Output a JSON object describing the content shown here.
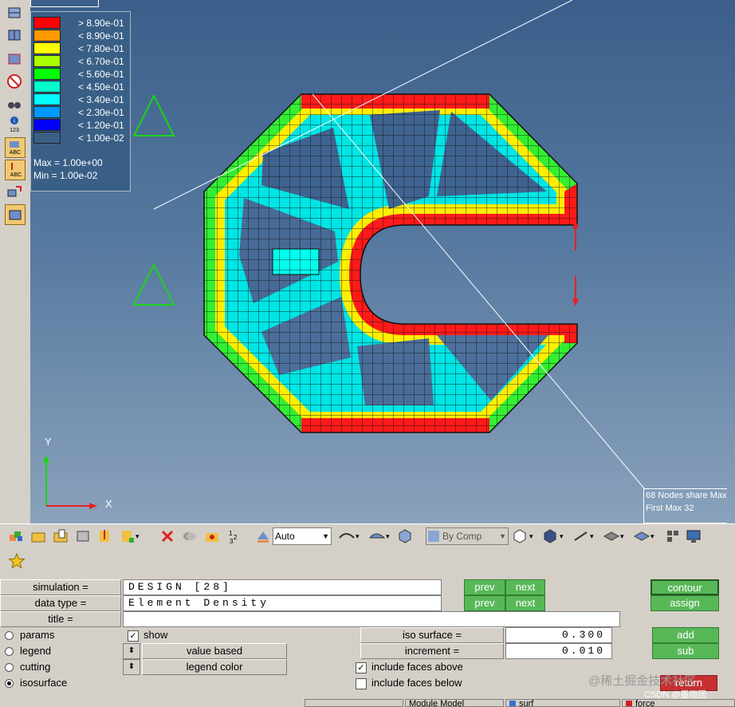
{
  "legend": {
    "entries": [
      {
        "label": "> 8.90e-01",
        "color": "#ff0000"
      },
      {
        "label": "< 8.90e-01",
        "color": "#ff9900"
      },
      {
        "label": "< 7.80e-01",
        "color": "#ffff00"
      },
      {
        "label": "< 6.70e-01",
        "color": "#aaff00"
      },
      {
        "label": "< 5.60e-01",
        "color": "#00ff00"
      },
      {
        "label": "< 4.50e-01",
        "color": "#00ffcc"
      },
      {
        "label": "< 3.40e-01",
        "color": "#00ffff"
      },
      {
        "label": "< 2.30e-01",
        "color": "#0099ff"
      },
      {
        "label": "< 1.20e-01",
        "color": "#0000ff"
      },
      {
        "label": "< 1.00e-02",
        "color": "#3a5f86"
      }
    ],
    "max_text": "Max = 1.00e+00",
    "min_text": "Min = 1.00e-02"
  },
  "axes": {
    "y_label": "Y",
    "x_label": "X"
  },
  "info_box": {
    "line1": "68 Nodes share Max",
    "line2": "First Max 32"
  },
  "toolbar": {
    "auto_label": "Auto",
    "bycomp_label": "By Comp"
  },
  "panel": {
    "simulation_label": "simulation =",
    "simulation_value": "DESIGN [28]",
    "data_type_label": "data type =",
    "data_type_value": "Element Density",
    "title_label": "title =",
    "title_value": "",
    "prev_label": "prev",
    "next_label": "next",
    "contour_label": "contour",
    "assign_label": "assign",
    "radios": [
      {
        "label": "params",
        "selected": false
      },
      {
        "label": "legend",
        "selected": false
      },
      {
        "label": "cutting",
        "selected": false
      },
      {
        "label": "isosurface",
        "selected": true
      }
    ],
    "show_label": "show",
    "value_based_label": "value based",
    "legend_color_label": "legend color",
    "iso_surface_label": "iso surface =",
    "iso_surface_value": "0.300",
    "increment_label": "increment =",
    "increment_value": "0.010",
    "include_above_label": "include faces above",
    "include_below_label": "include faces below",
    "add_label": "add",
    "sub_label": "sub",
    "return_label": "return"
  },
  "status": {
    "model": "Module Model",
    "comp": "surf",
    "force": "force"
  },
  "watermark": "@稀土掘金技术社区",
  "watermark2": "CSDN @墨雨团"
}
